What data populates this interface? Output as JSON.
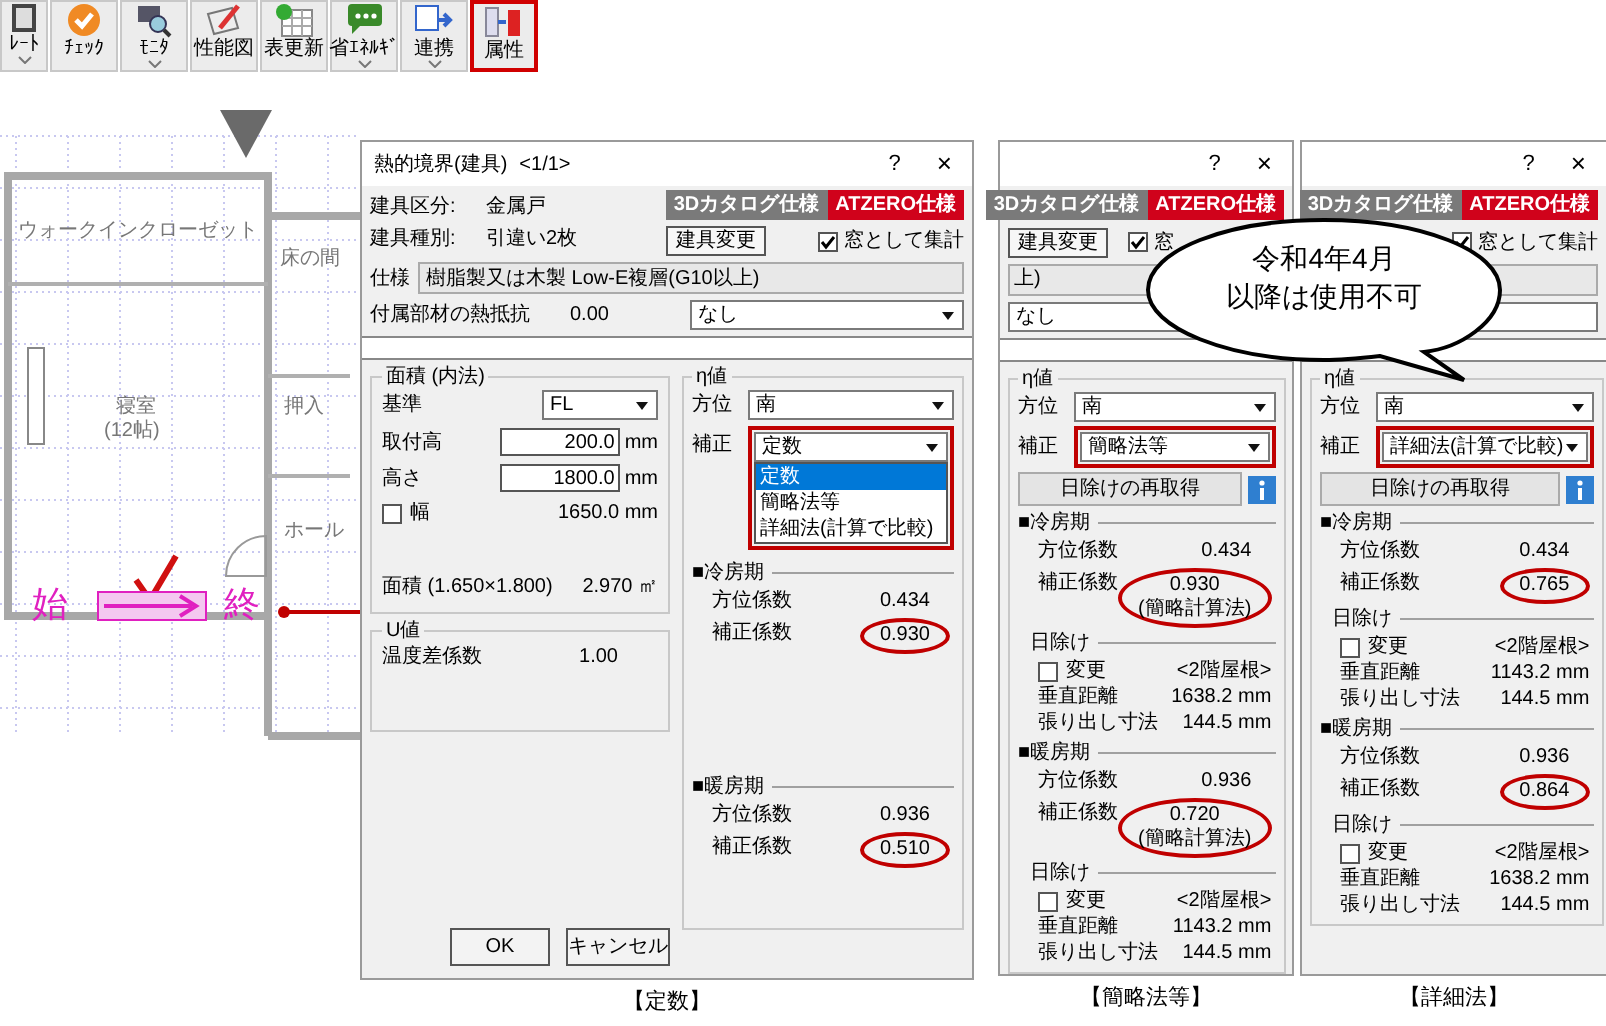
{
  "toolbar": {
    "items": [
      {
        "label": "ﾚｰﾄ",
        "dropdown": true,
        "highlighted": false
      },
      {
        "label": "ﾁｪｯｸ",
        "dropdown": false,
        "highlighted": false
      },
      {
        "label": "ﾓﾆﾀ",
        "dropdown": true,
        "highlighted": false
      },
      {
        "label": "性能図",
        "dropdown": false,
        "highlighted": false
      },
      {
        "label": "表更新",
        "dropdown": false,
        "highlighted": false
      },
      {
        "label": "省ｴﾈﾙｷﾞ",
        "dropdown": true,
        "highlighted": false
      },
      {
        "label": "連携",
        "dropdown": true,
        "highlighted": false
      },
      {
        "label": "属性",
        "dropdown": false,
        "highlighted": true
      }
    ]
  },
  "floor_plan": {
    "rooms": [
      "ウォークインクローゼット",
      "床の間",
      "寝室",
      "押入",
      "(12帖)",
      "ホール"
    ],
    "start_label": "始",
    "end_label": "終"
  },
  "dialog": {
    "title": "熱的境界(建具)",
    "page": "<1/1>",
    "help": "?",
    "close": "×",
    "info": [
      {
        "label": "建具区分:",
        "value": "金属戸"
      },
      {
        "label": "建具種別:",
        "value": "引違い2枚"
      }
    ],
    "tabs": [
      {
        "label": "3Dカタログ仕様",
        "selected": false
      },
      {
        "label": "ATZERO仕様",
        "selected": true
      }
    ],
    "change_button": "建具変更",
    "aggregate": {
      "label": "窓として集計",
      "checked": true
    },
    "spec": {
      "label": "仕様",
      "value": "樹脂製又は木製 Low-E複層(G10以上)"
    },
    "attachment": {
      "label": "付属部材の熱抵抗",
      "value": "0.00",
      "select": "なし"
    },
    "area": {
      "title": "面積 (内法)",
      "base": {
        "label": "基準",
        "value": "FL"
      },
      "mount": {
        "label": "取付高",
        "value": "200.0",
        "unit": "mm"
      },
      "height": {
        "label": "高さ",
        "value": "1800.0",
        "unit": "mm"
      },
      "width": {
        "label": "幅",
        "checked": false,
        "value": "1650.0",
        "unit": "mm"
      },
      "total": {
        "label": "面積 (1.650×1.800)",
        "value": "2.970",
        "unit": "㎡"
      }
    },
    "u": {
      "title": "U値",
      "label": "温度差係数",
      "value": "1.00"
    },
    "eta": {
      "title": "η値",
      "direction": {
        "label": "方位",
        "value": "南"
      },
      "correction": {
        "label": "補正",
        "value": "定数",
        "highlighted": true,
        "options": [
          {
            "label": "定数",
            "selected": true
          },
          {
            "label": "簡略法等",
            "selected": false
          },
          {
            "label": "詳細法(計算で比較)",
            "selected": false
          }
        ]
      },
      "periods": [
        {
          "title": "■冷房期",
          "rows": [
            {
              "label": "方位係数",
              "value": "0.434",
              "circled": false
            },
            {
              "label": "補正係数",
              "value": "0.930",
              "circled": true
            }
          ]
        },
        {
          "title": "■暖房期",
          "rows": [
            {
              "label": "方位係数",
              "value": "0.936",
              "circled": false
            },
            {
              "label": "補正係数",
              "value": "0.510",
              "circled": true
            }
          ]
        }
      ]
    },
    "buttons": [
      "OK",
      "キャンセル"
    ],
    "caption": "【定数】"
  },
  "variants": [
    {
      "help": "?",
      "close": "×",
      "tabs": [
        {
          "label": "3Dカタログ仕様",
          "selected": false
        },
        {
          "label": "ATZERO仕様",
          "selected": true
        }
      ],
      "change_button": "建具変更",
      "aggregate": {
        "label": "窓",
        "checked": true
      },
      "spec_fragment": "上)",
      "select": "なし",
      "eta": {
        "title": "η値",
        "direction": {
          "label": "方位",
          "value": "南"
        },
        "correction": {
          "label": "補正",
          "value": "簡略法等",
          "highlighted": true
        },
        "refresh_button": "日除けの再取得",
        "periods": [
          {
            "title": "■冷房期",
            "rows": [
              {
                "label": "方位係数",
                "value": "0.434",
                "circled": false
              },
              {
                "label": "補正係数",
                "value": "0.930",
                "note": "(簡略計算法)",
                "circled": true
              }
            ],
            "shade": {
              "title": "日除け",
              "change": {
                "label": "変更",
                "checked": false
              },
              "roof": "<2階屋根>",
              "rows": [
                {
                  "label": "垂直距離",
                  "value": "1638.2",
                  "unit": "mm"
                },
                {
                  "label": "張り出し寸法",
                  "value": "144.5",
                  "unit": "mm"
                }
              ]
            }
          },
          {
            "title": "■暖房期",
            "rows": [
              {
                "label": "方位係数",
                "value": "0.936",
                "circled": false
              },
              {
                "label": "補正係数",
                "value": "0.720",
                "note": "(簡略計算法)",
                "circled": true
              }
            ],
            "shade": {
              "title": "日除け",
              "change": {
                "label": "変更",
                "checked": false
              },
              "roof": "<2階屋根>",
              "rows": [
                {
                  "label": "垂直距離",
                  "value": "1143.2",
                  "unit": "mm"
                },
                {
                  "label": "張り出し寸法",
                  "value": "144.5",
                  "unit": "mm"
                }
              ]
            }
          }
        ]
      },
      "caption": "【簡略法等】"
    },
    {
      "help": "?",
      "close": "×",
      "tabs": [
        {
          "label": "3Dカタログ仕様",
          "selected": false
        },
        {
          "label": "ATZERO仕様",
          "selected": true
        }
      ],
      "aggregate": {
        "label": "窓として集計",
        "checked": true
      },
      "eta": {
        "title": "η値",
        "direction": {
          "label": "方位",
          "value": "南"
        },
        "correction": {
          "label": "補正",
          "value": "詳細法(計算で比較)",
          "highlighted": true
        },
        "refresh_button": "日除けの再取得",
        "periods": [
          {
            "title": "■冷房期",
            "rows": [
              {
                "label": "方位係数",
                "value": "0.434",
                "circled": false
              },
              {
                "label": "補正係数",
                "value": "0.765",
                "circled": true
              }
            ],
            "shade": {
              "title": "日除け",
              "change": {
                "label": "変更",
                "checked": false
              },
              "roof": "<2階屋根>",
              "rows": [
                {
                  "label": "垂直距離",
                  "value": "1143.2",
                  "unit": "mm"
                },
                {
                  "label": "張り出し寸法",
                  "value": "144.5",
                  "unit": "mm"
                }
              ]
            }
          },
          {
            "title": "■暖房期",
            "rows": [
              {
                "label": "方位係数",
                "value": "0.936",
                "circled": false
              },
              {
                "label": "補正係数",
                "value": "0.864",
                "circled": true
              }
            ],
            "shade": {
              "title": "日除け",
              "change": {
                "label": "変更",
                "checked": false
              },
              "roof": "<2階屋根>",
              "rows": [
                {
                  "label": "垂直距離",
                  "value": "1638.2",
                  "unit": "mm"
                },
                {
                  "label": "張り出し寸法",
                  "value": "144.5",
                  "unit": "mm"
                }
              ]
            }
          }
        ]
      },
      "caption": "【詳細法】"
    }
  ],
  "callout": {
    "lines": [
      "令和4年4月",
      "以降は使用不可"
    ]
  }
}
